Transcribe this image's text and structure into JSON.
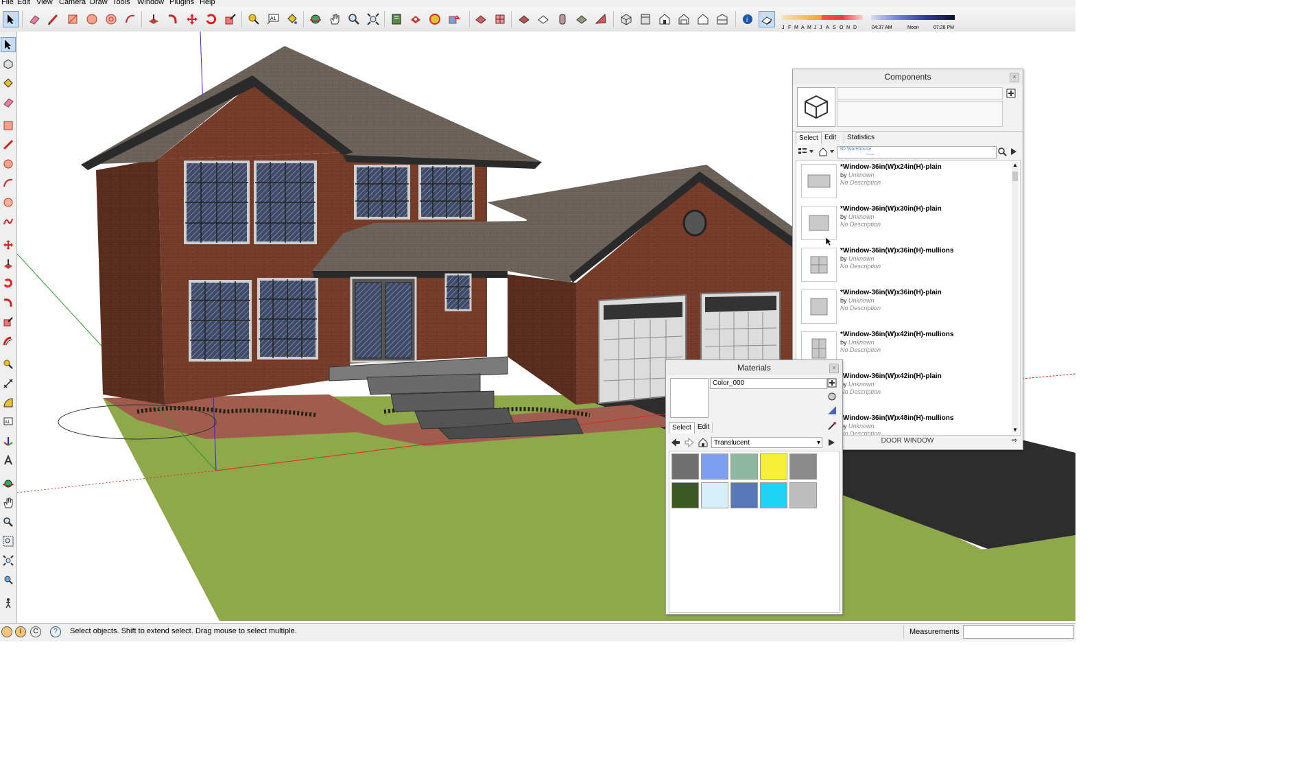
{
  "menu": [
    "File",
    "Edit",
    "View",
    "Camera",
    "Draw",
    "Tools",
    "Window",
    "Plugins",
    "Help"
  ],
  "shadow": {
    "months": [
      "J",
      "F",
      "M",
      "A",
      "M",
      "J",
      "J",
      "A",
      "S",
      "O",
      "N",
      "D"
    ],
    "time_start": "04:37 AM",
    "time_mid": "Noon",
    "time_end": "07:28 PM"
  },
  "status": {
    "hint": "Select objects. Shift to extend select. Drag mouse to select multiple.",
    "measurements_label": "Measurements",
    "measurements_value": ""
  },
  "components": {
    "title": "Components",
    "tabs": [
      "Select",
      "Edit",
      "Statistics"
    ],
    "search_label": "3D Warehouse",
    "search_sub": "Google",
    "items": [
      {
        "name": "*Window-36in(W)x24in(H)-plain",
        "by": "by",
        "author": "Unknown",
        "desc": "No Description"
      },
      {
        "name": "*Window-36in(W)x30in(H)-plain",
        "by": "by",
        "author": "Unknown",
        "desc": "No Description"
      },
      {
        "name": "*Window-36in(W)x36in(H)-mullions",
        "by": "by",
        "author": "Unknown",
        "desc": "No Description"
      },
      {
        "name": "*Window-36in(W)x36in(H)-plain",
        "by": "by",
        "author": "Unknown",
        "desc": "No Description"
      },
      {
        "name": "*Window-36in(W)x42in(H)-mullions",
        "by": "by",
        "author": "Unknown",
        "desc": "No Description"
      },
      {
        "name": "*Window-36in(W)x42in(H)-plain",
        "by": "by",
        "author": "Unknown",
        "desc": "No Description"
      },
      {
        "name": "*Window-36in(W)x48in(H)-mullions",
        "by": "by",
        "author": "Unknown",
        "desc": "No Description"
      }
    ],
    "footer": "DOOR WINDOW"
  },
  "materials": {
    "title": "Materials",
    "name_value": "Color_000",
    "tabs": [
      "Select",
      "Edit"
    ],
    "library": "Translucent",
    "swatch_colors": [
      "#6f6f6f",
      "#7d9ff0",
      "#8fb8a3",
      "#f5f035",
      "#8a8a8a",
      "#3b5a22",
      "#d5eef7",
      "#5a77b8",
      "#1fd3f5",
      "#bdbdbd"
    ]
  },
  "colors": {
    "sky": "#ffffff",
    "grass": "#8ea84a",
    "brick": "#7a3f2b",
    "roof": "#6b625a",
    "asphalt": "#2d2d2d"
  }
}
